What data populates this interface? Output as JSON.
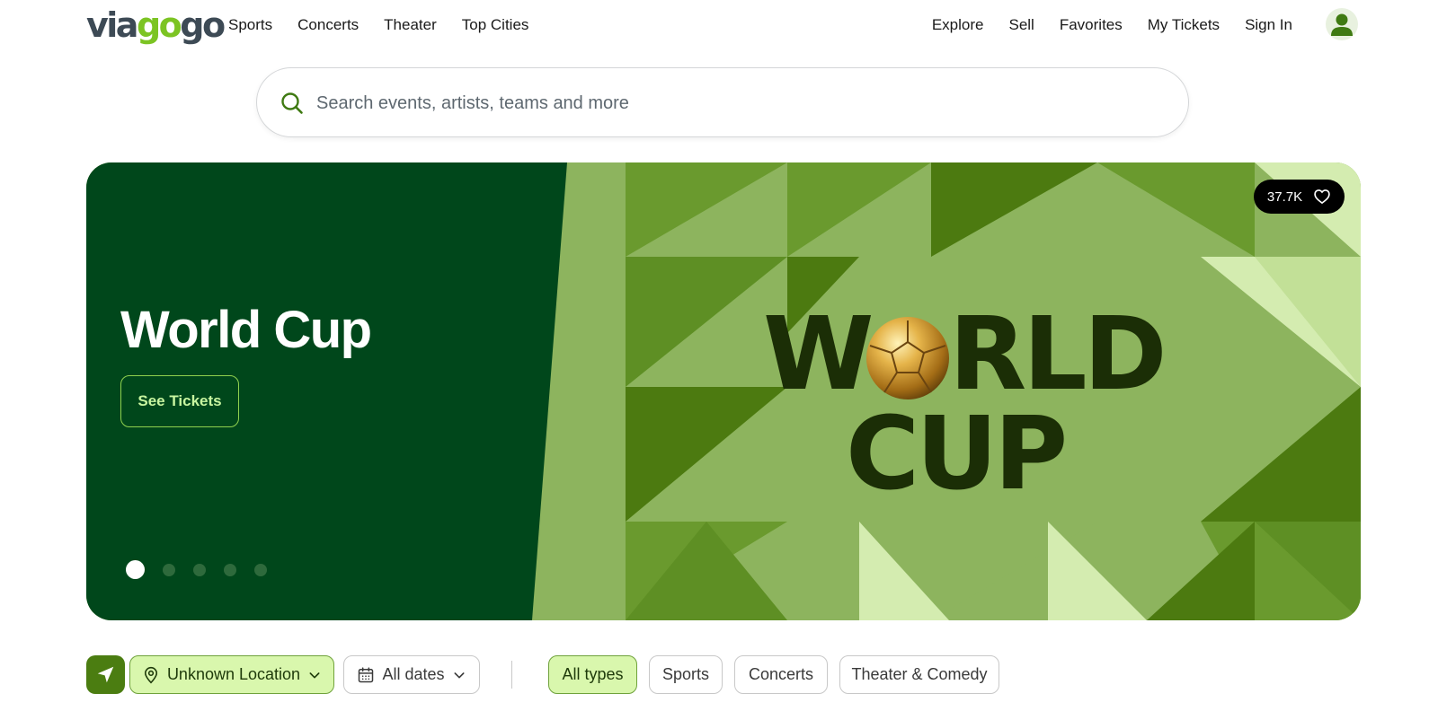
{
  "brand": {
    "logo": {
      "part1": "via",
      "part2": "go",
      "part3": "go"
    },
    "colors": {
      "dark_green": "#00471b",
      "accent_green": "#4b7d11",
      "chip_green": "#d9f7ad",
      "logo_green": "#7cc423"
    }
  },
  "header": {
    "nav_left": [
      "Sports",
      "Concerts",
      "Theater",
      "Top Cities"
    ],
    "nav_right": [
      "Explore",
      "Sell",
      "Favorites",
      "My Tickets",
      "Sign In"
    ],
    "avatar_icon": "user-avatar-icon"
  },
  "search": {
    "placeholder": "Search events, artists, teams and more",
    "icon": "search-icon"
  },
  "hero": {
    "title": "World Cup",
    "cta_label": "See Tickets",
    "favorites_count": "37.7K",
    "artwork_text": {
      "line1_a": "W",
      "line1_b": "RLD",
      "line2": "CUP"
    },
    "carousel": {
      "total_slides": 5,
      "active_slide": 1
    }
  },
  "filters": {
    "location_button_icon": "navigation-arrow-icon",
    "location_label": "Unknown Location",
    "dates_label": "All dates",
    "types": [
      "All types",
      "Sports",
      "Concerts",
      "Theater & Comedy"
    ],
    "active_type": "All types"
  }
}
